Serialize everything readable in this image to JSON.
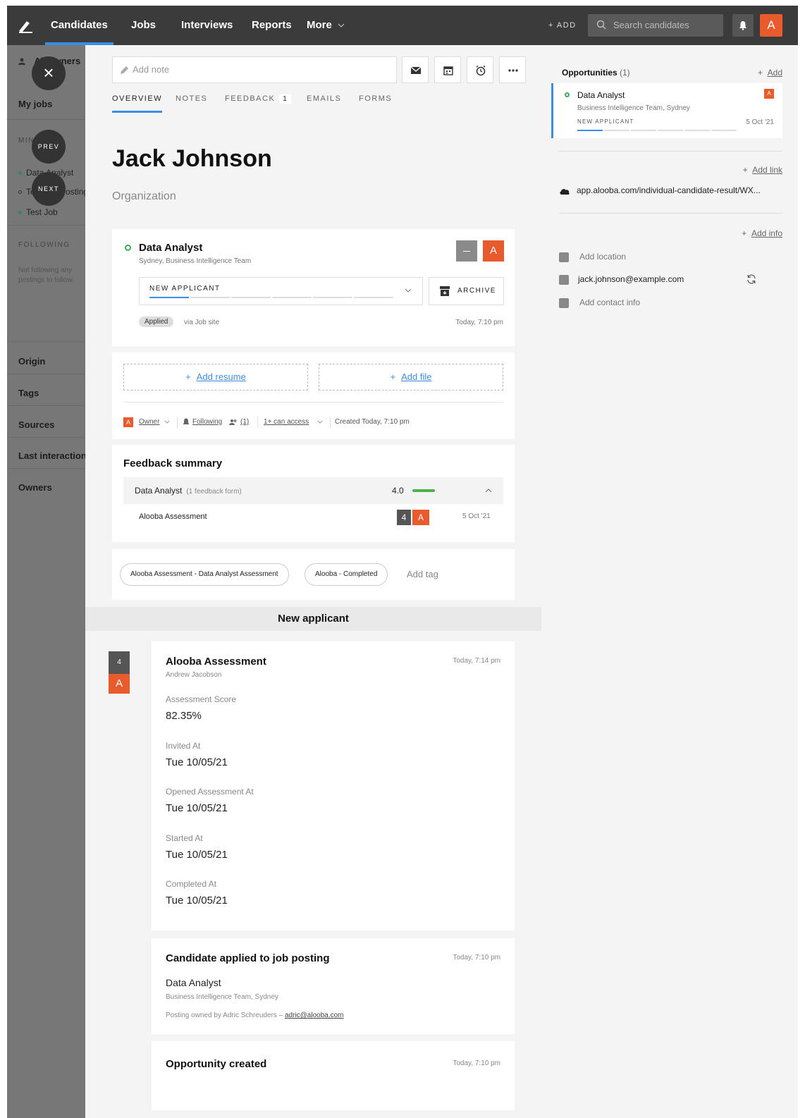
{
  "nav": {
    "items": [
      "Candidates",
      "Jobs",
      "Interviews",
      "Reports",
      "More"
    ],
    "add_label": "+ ADD",
    "search_placeholder": "Search candidates",
    "avatar_letter": "A"
  },
  "sidebar": {
    "all_owners_label": "All owners",
    "my_jobs": "My jobs",
    "mine_caption": "MINE",
    "jobs": [
      "Data Analyst",
      "Test Job Posting",
      "Test Job"
    ],
    "following_caption": "FOLLOWING",
    "following_empty": "Not following any postings to follow.",
    "filters": [
      "Origin",
      "Tags",
      "Sources",
      "Last interaction",
      "Owners"
    ],
    "close_label": "×",
    "prev_label": "PREV",
    "next_label": "NEXT"
  },
  "main": {
    "note_placeholder": "Add note",
    "tabs": [
      {
        "label": "OVERVIEW"
      },
      {
        "label": "NOTES"
      },
      {
        "label": "FEEDBACK",
        "count": "1"
      },
      {
        "label": "EMAILS"
      },
      {
        "label": "FORMS"
      }
    ],
    "candidate_name": "Jack Johnson",
    "organization": "Organization",
    "opportunity": {
      "title": "Data Analyst",
      "subtitle": "Sydney, Business Intelligence Team",
      "avatar_letter": "A",
      "stage": "NEW APPLICANT",
      "stage_progress": 0.17,
      "archive_label": "ARCHIVE",
      "applied_badge": "Applied",
      "source": "via Job site",
      "applied_time": "Today, 7:10 pm"
    },
    "files": {
      "add_resume": "Add resume",
      "add_file": "Add file",
      "owner_badge": "A",
      "owner_label": "Owner",
      "following_label": "Following",
      "following_count": "(1)",
      "access_label": "1+ can access",
      "created": "Created Today, 7:10 pm"
    },
    "feedback": {
      "title": "Feedback summary",
      "job": "Data Analyst",
      "forms_count": "(1 feedback form)",
      "score": "4.0",
      "item": "Alooba Assessment",
      "item_score": "4",
      "item_avatar": "A",
      "item_date": "5 Oct '21"
    },
    "tags": [
      "Alooba Assessment - Data Analyst Assessment",
      "Alooba - Completed"
    ],
    "add_tag": "Add tag",
    "section_header": "New applicant",
    "timeline": {
      "badge_number": "4",
      "badge_letter": "A",
      "assessment": {
        "title": "Alooba Assessment",
        "author": "Andrew Jacobson",
        "time": "Today, 7:14 pm",
        "fields": [
          {
            "label": "Assessment Score",
            "value": "82.35%"
          },
          {
            "label": "Invited At",
            "value": "Tue 10/05/21"
          },
          {
            "label": "Opened Assessment At",
            "value": "Tue 10/05/21"
          },
          {
            "label": "Started At",
            "value": "Tue 10/05/21"
          },
          {
            "label": "Completed At",
            "value": "Tue 10/05/21"
          }
        ]
      },
      "applied": {
        "title": "Candidate applied to job posting",
        "time": "Today, 7:10 pm",
        "job": "Data Analyst",
        "sub": "Business Intelligence Team, Sydney",
        "posting_prefix": "Posting owned by Adric Schreuders – ",
        "posting_email": "adric@alooba.com"
      },
      "created": {
        "title": "Opportunity created",
        "time": "Today, 7:10 pm"
      }
    }
  },
  "right": {
    "opportunities_label": "Opportunities",
    "opportunities_count": "(1)",
    "add_label": "Add",
    "opp": {
      "title": "Data Analyst",
      "sub": "Business Intelligence Team, Sydney",
      "stage": "NEW APPLICANT",
      "date": "5 Oct '21",
      "avatar": "A"
    },
    "add_link_label": "Add link",
    "link": "app.alooba.com/individual-candidate-result/WX...",
    "add_info_label": "Add info",
    "add_location": "Add location",
    "email": "jack.johnson@example.com",
    "add_contact": "Add contact info"
  },
  "colors": {
    "accent": "#3b8ee6",
    "brand_orange": "#e95a2d",
    "nav_bg": "#3b3b3b",
    "status_green": "#3cae5a"
  }
}
